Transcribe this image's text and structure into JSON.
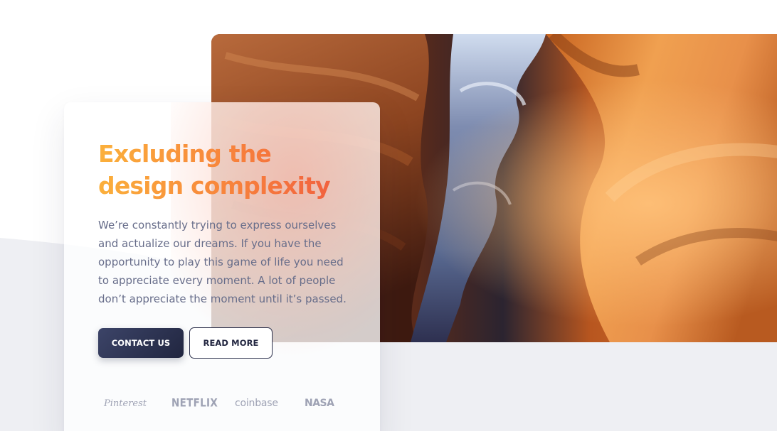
{
  "hero": {
    "title_line1": "Excluding the",
    "title_line2": "design complexity",
    "description_lines": [
      "We’re constantly trying to express ourselves",
      "and actualize our dreams. If you have the",
      "opportunity to play this game of life you need",
      "to appreciate every moment. A lot of people",
      "don’t appreciate the moment until it’s passed."
    ],
    "image_subject": "canyon-photo"
  },
  "buttons": {
    "primary_label": "CONTACT US",
    "secondary_label": "READ MORE"
  },
  "logos": [
    "Pinterest",
    "NETFLIX",
    "coinbase",
    "NASA"
  ],
  "colors": {
    "title_gradient_start": "#fbb03b",
    "title_gradient_end": "#f05a3f",
    "text": "#676d8a",
    "button_dark": "#2b2f4a",
    "logo_gray": "#9ea2b4",
    "background_wave": "#eeeff3"
  }
}
